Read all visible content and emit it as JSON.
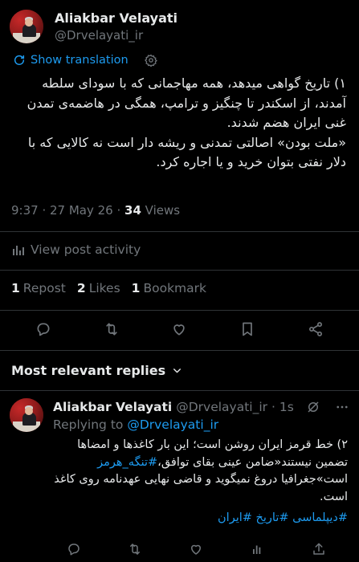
{
  "tweet": {
    "author_name": "Aliakbar Velayati",
    "author_handle": "@Drvelayati_ir",
    "show_translation": "Show translation",
    "text_lines": [
      "۱) تاریخ گواهی میدهد، همه مهاجمانی که با سودای سلطه آمدند، از اسکندر تا چنگیز و ترامپ، همگی در هاضمه‌ی تمدن غنی ایران هضم شدند.",
      "«ملت بودن» اصالتی تمدنی و ریشه دار است نه کالایی که با دلار نفتی بتوان خرید و یا اجاره کرد."
    ],
    "time": "9:37 · 27 May 26 · ",
    "views_count": "34",
    "views_label": " Views",
    "view_activity": "View post activity",
    "stats": {
      "reposts_count": "1",
      "reposts_label": "Repost",
      "likes_count": "2",
      "likes_label": "Likes",
      "bookmarks_count": "1",
      "bookmarks_label": "Bookmark"
    },
    "actions": [
      "reply-icon",
      "repost-icon",
      "like-icon",
      "bookmark-icon",
      "share-icon"
    ]
  },
  "replies_header": "Most relevant replies",
  "reply": {
    "author_name": "Aliakbar Velayati",
    "author_handle": "@Drvelayati_ir",
    "dot_time": "· 1s",
    "replying_to_prefix": "Replying to ",
    "replying_to_handle": "@Drvelayati_ir",
    "text_part1": "۲) خط قرمز ایران روشن است؛ این بار کاغذها و امضاها تضمین نیستند«ضامن عینی بقای توافق،",
    "hashtag_inline": "#تنگه_هرمز",
    "text_part2": " است»جغرافیا دروغ نمیگوید و قاضی نهایی عهدنامه روی کاغذ است.",
    "hashtags": "#دیپلماسی #تاریخ #ایران"
  },
  "colors": {
    "background": "#000000",
    "text": "#e7e9ea",
    "muted": "#71767b",
    "accent": "#1d9bf0",
    "divider": "#2f3336"
  }
}
